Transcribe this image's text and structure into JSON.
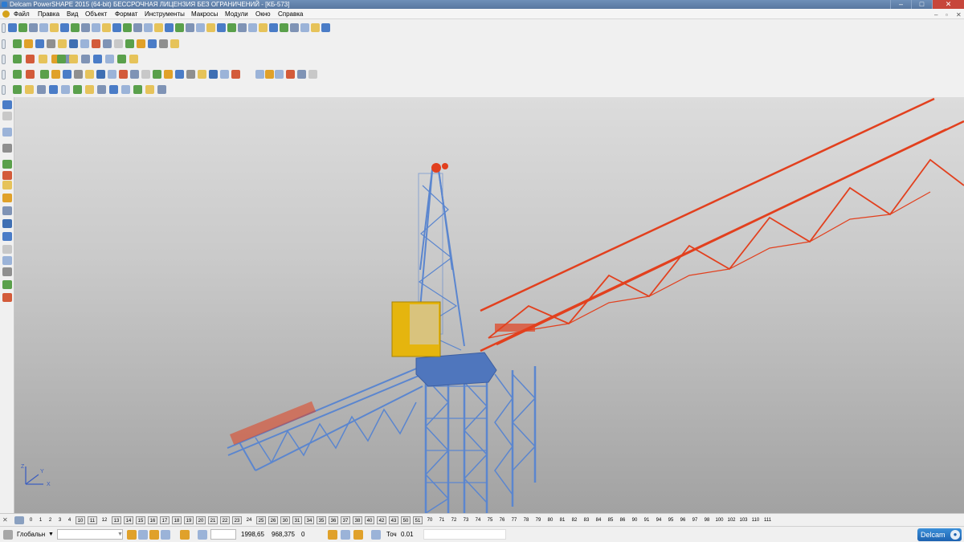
{
  "window": {
    "title": "Delcam PowerSHAPE 2015 (64-bit) БЕССРОЧНАЯ ЛИЦЕНЗИЯ БЕЗ ОГРАНИЧЕНИЙ - [КБ-573]",
    "minimize": "–",
    "maximize": "□",
    "close": "✕"
  },
  "menu": {
    "items": [
      "Файл",
      "Правка",
      "Вид",
      "Объект",
      "Формат",
      "Инструменты",
      "Макросы",
      "Модули",
      "Окно",
      "Справка"
    ],
    "mdi_min": "–",
    "mdi_restore": "▫",
    "mdi_close": "✕"
  },
  "levels": {
    "numbers": [
      "0",
      "1",
      "2",
      "3",
      "4",
      "10",
      "11",
      "12",
      "13",
      "14",
      "15",
      "16",
      "17",
      "18",
      "19",
      "20",
      "21",
      "22",
      "23",
      "24",
      "25",
      "26",
      "30",
      "31",
      "34",
      "35",
      "36",
      "37",
      "38",
      "40",
      "42",
      "43",
      "50",
      "51",
      "70",
      "71",
      "72",
      "73",
      "74",
      "75",
      "76",
      "77",
      "78",
      "79",
      "80",
      "81",
      "82",
      "83",
      "84",
      "85",
      "86",
      "90",
      "91",
      "94",
      "95",
      "96",
      "97",
      "98",
      "100",
      "102",
      "103",
      "110",
      "111"
    ],
    "boxed": [
      "10",
      "11",
      "13",
      "14",
      "15",
      "16",
      "17",
      "18",
      "19",
      "20",
      "21",
      "22",
      "23",
      "25",
      "26",
      "30",
      "31",
      "34",
      "35",
      "36",
      "37",
      "38",
      "40",
      "42",
      "43",
      "50",
      "51"
    ]
  },
  "status": {
    "workplane": "Глобальн",
    "x": "1998,65",
    "y": "968,375",
    "z": "0",
    "tolerance_label": "Точ",
    "tolerance": "0.01"
  },
  "brand": "Delcam",
  "colors": {
    "tower": "#5b86cf",
    "jib": "#e2401e",
    "cabin": "#e5b50e",
    "title_bar": "#6383ad"
  },
  "axis": {
    "z": "Z",
    "y": "Y",
    "x": "X"
  }
}
